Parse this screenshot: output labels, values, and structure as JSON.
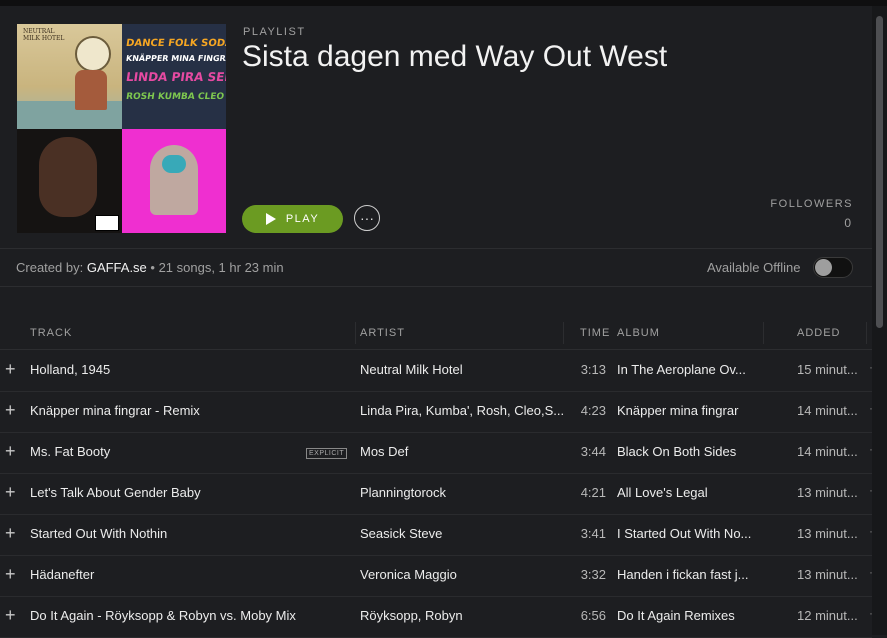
{
  "playlist": {
    "eyebrow": "PLAYLIST",
    "title": "Sista dagen med Way Out West",
    "play_label": "PLAY",
    "more_label": "···",
    "followers_label": "FOLLOWERS",
    "followers_count": "0",
    "created_by_label": "Created by: ",
    "owner": "GAFFA.se",
    "summary": " • 21 songs, 1 hr 23 min",
    "offline_label": "Available Offline",
    "offline_enabled": false
  },
  "cover_art": {
    "tile1_label": "NEUTRAL\nMILK HOTEL",
    "tile2_lines": [
      "DANCE FOLK SODA",
      "KNÄPPER MINA FINGRAR",
      "LINDA PIRA SEP",
      "ROSH KUMBA CLEO"
    ]
  },
  "table": {
    "headers": {
      "track": "TRACK",
      "artist": "ARTIST",
      "time": "TIME",
      "album": "ALBUM",
      "added": "ADDED"
    },
    "rows": [
      {
        "track": "Holland, 1945",
        "artist": "Neutral Milk Hotel",
        "time": "3:13",
        "album": "In The Aeroplane Ov...",
        "added": "15 minut...",
        "explicit": ""
      },
      {
        "track": "Knäpper mina fingrar - Remix",
        "artist": "Linda Pira, Kumba', Rosh, Cleo,S...",
        "time": "4:23",
        "album": "Knäpper mina fingrar",
        "added": "14 minut...",
        "explicit": ""
      },
      {
        "track": "Ms. Fat Booty",
        "artist": "Mos Def",
        "time": "3:44",
        "album": "Black On Both Sides",
        "added": "14 minut...",
        "explicit": "EXPLICIT"
      },
      {
        "track": "Let's Talk About Gender Baby",
        "artist": "Planningtorock",
        "time": "4:21",
        "album": "All Love's Legal",
        "added": "13 minut...",
        "explicit": ""
      },
      {
        "track": "Started Out With Nothin",
        "artist": "Seasick Steve",
        "time": "3:41",
        "album": "I Started Out With No...",
        "added": "13 minut...",
        "explicit": ""
      },
      {
        "track": "Hädanefter",
        "artist": "Veronica Maggio",
        "time": "3:32",
        "album": "Handen i fickan fast j...",
        "added": "13 minut...",
        "explicit": ""
      },
      {
        "track": "Do It Again - Röyksopp & Robyn vs. Moby Mix",
        "artist": "Röyksopp, Robyn",
        "time": "6:56",
        "album": "Do It Again Remixes",
        "added": "12 minut...",
        "explicit": ""
      }
    ]
  },
  "colors": {
    "background": "#1d1e21",
    "accent": "#6b9b22",
    "text": "#e8e8e8",
    "muted": "#a0a0a0"
  }
}
